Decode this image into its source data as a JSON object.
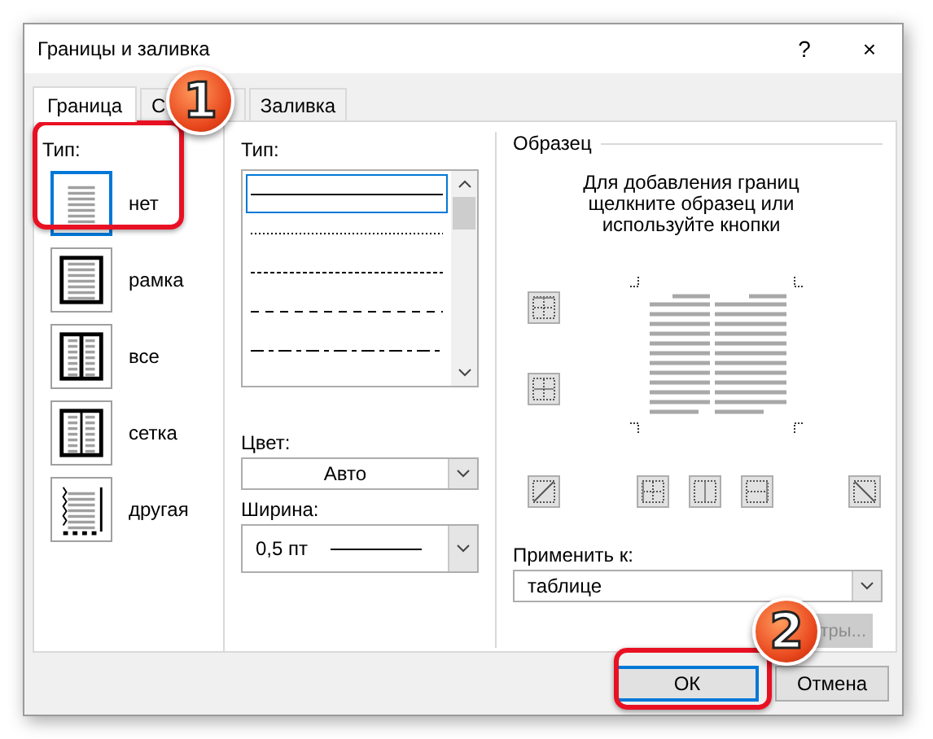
{
  "window": {
    "title": "Границы и заливка",
    "help": "?",
    "close": "×"
  },
  "tabs": [
    {
      "label": "Граница",
      "selected": true
    },
    {
      "label": "С",
      "selected": false
    },
    {
      "label": "Заливка",
      "selected": false
    }
  ],
  "type_section": {
    "label": "Тип:",
    "presets": [
      {
        "label": "нет",
        "kind": "none",
        "selected": true
      },
      {
        "label": "рамка",
        "kind": "box",
        "selected": false
      },
      {
        "label": "все",
        "kind": "all",
        "selected": false
      },
      {
        "label": "сетка",
        "kind": "grid",
        "selected": false
      },
      {
        "label": "другая",
        "kind": "custom",
        "selected": false
      }
    ]
  },
  "line_section": {
    "label": "Тип:",
    "styles": [
      {
        "kind": "solid",
        "selected": true
      },
      {
        "kind": "dotted",
        "selected": false
      },
      {
        "kind": "fine-dashed",
        "selected": false
      },
      {
        "kind": "dashed",
        "selected": false
      },
      {
        "kind": "dash-dot",
        "selected": false
      }
    ],
    "color_label": "Цвет:",
    "color_value": "Авто",
    "width_label": "Ширина:",
    "width_value": "0,5 пт"
  },
  "preview": {
    "title": "Образец",
    "hint": "Для добавления границ щелкните образец или используйте кнопки",
    "apply_label": "Применить к:",
    "apply_value": "таблице",
    "options_button": "тры...",
    "options_disabled": true
  },
  "buttons": [
    {
      "label": "ОК",
      "selected": true
    },
    {
      "label": "Отмена",
      "selected": false
    }
  ],
  "annotations": [
    {
      "label": "1"
    },
    {
      "label": "2"
    }
  ]
}
